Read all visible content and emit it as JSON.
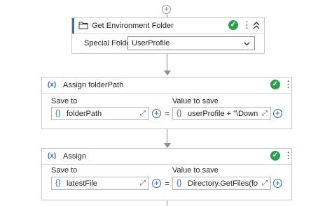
{
  "activities": [
    {
      "title": "Get Environment Folder",
      "special_folder_label": "Special Folder",
      "special_folder_value": "UserProfile"
    },
    {
      "icon_text": "(x)",
      "title": "Assign folderPath",
      "save_to_label": "Save to",
      "value_to_save_label": "Value to save",
      "save_to_value": "folderPath",
      "value_to_save_value": "userProfile + \"\\Downl",
      "equals": "="
    },
    {
      "icon_text": "(x)",
      "title": "Assign",
      "save_to_label": "Save to",
      "value_to_save_label": "Value to save",
      "save_to_value": "latestFile",
      "value_to_save_value": "Directory.GetFiles(fold",
      "equals": "="
    }
  ],
  "icons": {
    "add": "plus-circle-icon",
    "folder": "folder-icon",
    "status": "check-circle-icon",
    "menu": "kebab-menu-icon",
    "collapse": "chevron-double-up-icon",
    "variable": "variable-icon",
    "expression": "braces-icon",
    "expand": "expand-diagonal-icon"
  },
  "colors": {
    "accent": "#2f6fbf",
    "valid": "#2e9f4f"
  }
}
